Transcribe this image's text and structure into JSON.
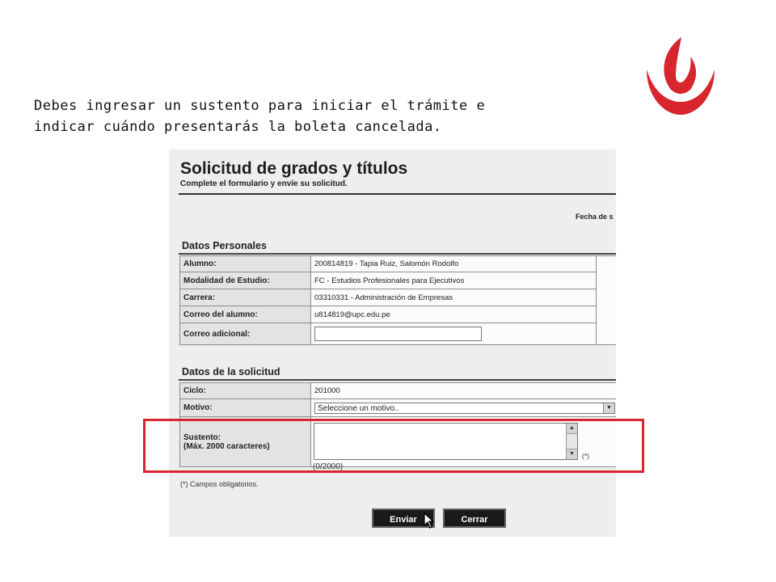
{
  "caption": "Debes ingresar un sustento para iniciar el trámite e\nindicar cuándo presentarás la boleta cancelada.",
  "form": {
    "title": "Solicitud de grados y títulos",
    "subtitle": "Complete el formulario y envíe su solicitud.",
    "fecha_label": "Fecha de s",
    "personal_section": "Datos Personales",
    "personal_rows": [
      {
        "label": "Alumno:",
        "value": "200814819 - Tapia Ruiz, Salomón Rodolfo"
      },
      {
        "label": "Modalidad de Estudio:",
        "value": "FC - Estudios Profesionales para Ejecutivos"
      },
      {
        "label": "Carrera:",
        "value": "03310331 - Administración de Empresas"
      },
      {
        "label": "Correo del alumno:",
        "value": "u814819@upc.edu.pe"
      },
      {
        "label": "Correo adicional:",
        "value": ""
      }
    ],
    "solicitud_section": "Datos de la solicitud",
    "ciclo": {
      "label": "Ciclo:",
      "value": "201000"
    },
    "motivo": {
      "label": "Motivo:",
      "selected": "Seleccione un motivo.."
    },
    "sustento": {
      "label_line1": "Sustento:",
      "label_line2": "(Máx. 2000 caracteres)",
      "counter": "(0/2000)",
      "required_mark": "(*)"
    },
    "required_note": "(*) Campos obligatorios.",
    "buttons": {
      "enviar": "Enviar",
      "cerrar": "Cerrar"
    }
  },
  "colors": {
    "brand_red": "#d7262e",
    "button_dark": "#1a1a1a"
  }
}
